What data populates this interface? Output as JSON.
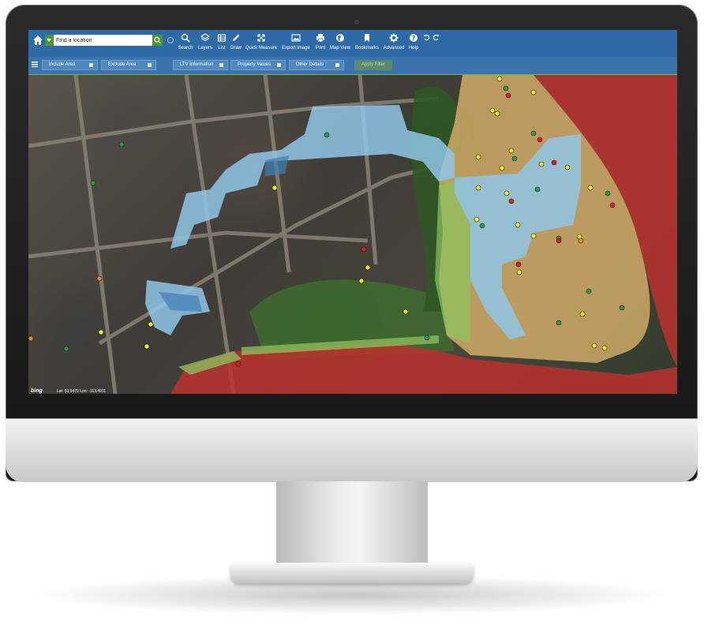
{
  "toolbar": {
    "search": {
      "placeholder": "Find a location",
      "value": "Find a location"
    },
    "tools": [
      {
        "label": "Search",
        "icon": "search-icon"
      },
      {
        "label": "Layers",
        "icon": "layers-icon"
      },
      {
        "label": "List",
        "icon": "list-icon"
      },
      {
        "label": "Draw",
        "icon": "pencil-icon"
      },
      {
        "label": "Quick Measure",
        "icon": "measure-icon"
      },
      {
        "label": "Export Image",
        "icon": "image-icon"
      },
      {
        "label": "Print",
        "icon": "print-icon"
      },
      {
        "label": "Map View",
        "icon": "globe-icon"
      },
      {
        "label": "Bookmarks",
        "icon": "bookmark-icon"
      },
      {
        "label": "Advanced",
        "icon": "gear-icon"
      },
      {
        "label": "Help",
        "icon": "help-icon"
      }
    ]
  },
  "filters": {
    "buttons": [
      {
        "label": "Include Area"
      },
      {
        "label": "Exclude Area"
      },
      {
        "label": "LTV Information"
      },
      {
        "label": "Property Values"
      },
      {
        "label": "Other Details"
      }
    ],
    "apply_label": "Apply Filter"
  },
  "map": {
    "attribution": "bing",
    "coordinates": "Lat: 53.5479 Lon: -113.4911",
    "colors": {
      "flood_high": "#c0312c",
      "flood_medium": "#d2a85b",
      "flood_low": "#87c35a",
      "water_extent": "#8fc6e6",
      "marker_red": "#e11d1d",
      "marker_yellow": "#f2ee2a",
      "marker_green": "#2e9a44",
      "marker_orange": "#ef8a1f"
    }
  },
  "theme": {
    "toolbar": "#2d6aa6",
    "filterbar": "#3b74ad",
    "accent": "#4d9a2a"
  }
}
